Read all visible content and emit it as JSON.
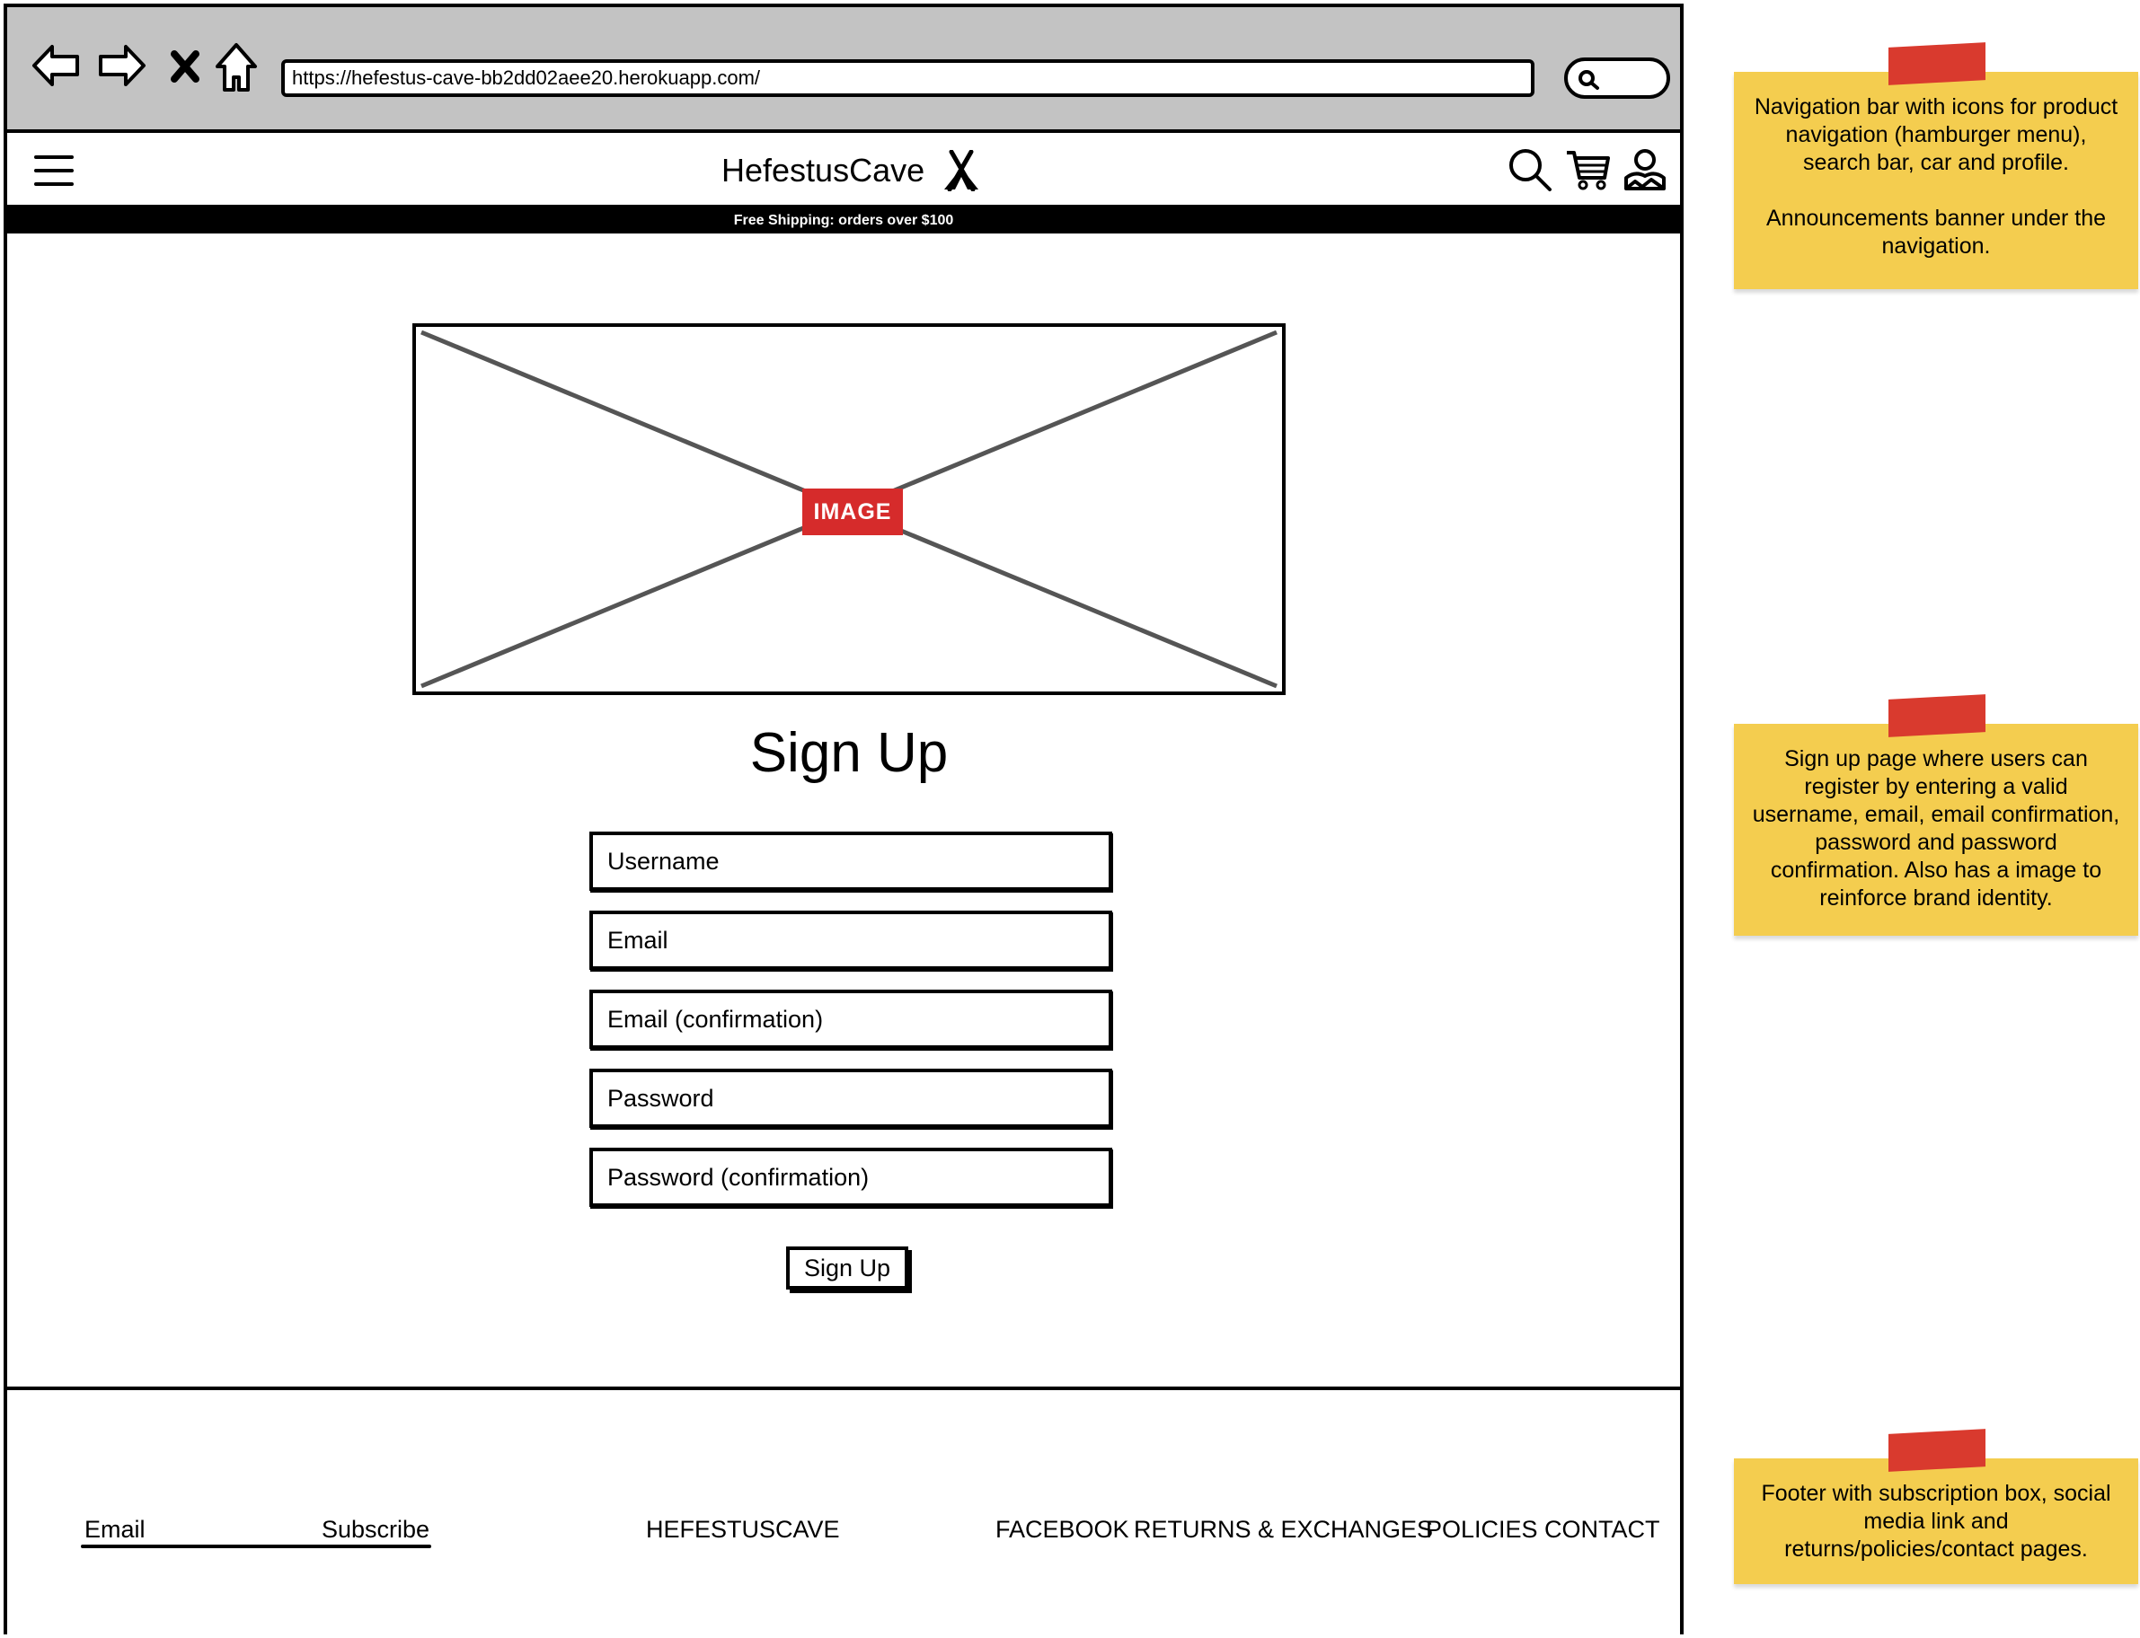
{
  "browser": {
    "url": "https://hefestus-cave-bb2dd02aee20.herokuapp.com/"
  },
  "header": {
    "brand": "HefestusCave",
    "banner": "Free Shipping: orders over $100"
  },
  "main": {
    "image_label": "IMAGE",
    "title": "Sign Up",
    "fields": [
      "Username",
      "Email",
      "Email (confirmation)",
      "Password",
      "Password (confirmation)"
    ],
    "submit_label": "Sign Up"
  },
  "footer": {
    "email_label": "Email",
    "subscribe_label": "Subscribe",
    "brand": "HEFESTUSCAVE",
    "links": [
      "FACEBOOK",
      "RETURNS & EXCHANGES",
      "POLICIES",
      "CONTACT"
    ]
  },
  "notes": [
    {
      "line1": "Navigation bar with icons for product navigation (hamburger menu), search bar, car and profile.",
      "line2": "Announcements banner under the navigation."
    },
    {
      "line1": "Sign up page where users can register by entering a valid username, email, email confirmation, password and password confirmation. Also has a image to reinforce brand identity."
    },
    {
      "line1": "Footer with subscription box, social media link and returns/policies/contact pages."
    }
  ],
  "colors": {
    "chrome": "#c3c3c3",
    "image_badge": "#d62b2b",
    "note": "#f4cd4f",
    "tape": "#d93a2e"
  },
  "icons": [
    "back-arrow-icon",
    "forward-arrow-icon",
    "stop-icon",
    "home-icon",
    "search-icon",
    "hamburger-icon",
    "tent-icon",
    "cart-icon",
    "profile-icon"
  ]
}
